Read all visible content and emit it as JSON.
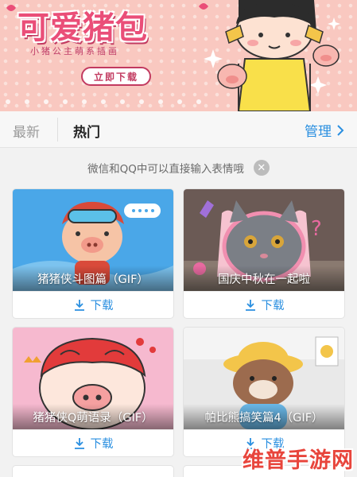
{
  "banner": {
    "title": "可爱猪包",
    "subtitle": "小猪公主萌系插画",
    "download_button": "立即下载"
  },
  "tabs": {
    "recent": "最新",
    "hot": "热门",
    "manage": "管理"
  },
  "notice": {
    "text": "微信和QQ中可以直接输入表情哦"
  },
  "cards": [
    {
      "title": "猪猪侠斗图篇（GIF）",
      "download": "下载"
    },
    {
      "title": "国庆中秋在一起啦",
      "download": "下载"
    },
    {
      "title": "猪猪侠Q萌语录（GIF）",
      "download": "下载"
    },
    {
      "title": "帕比熊搞笑篇4（GIF）",
      "download": "下载"
    }
  ],
  "watermark": "维普手游网",
  "colors": {
    "accent": "#2a8fe0",
    "banner_bg": "#f9c8c0",
    "banner_title": "#ea4e78",
    "watermark": "#e8453c"
  },
  "icons": [
    "download-icon",
    "chevron-right-icon",
    "close-icon"
  ]
}
